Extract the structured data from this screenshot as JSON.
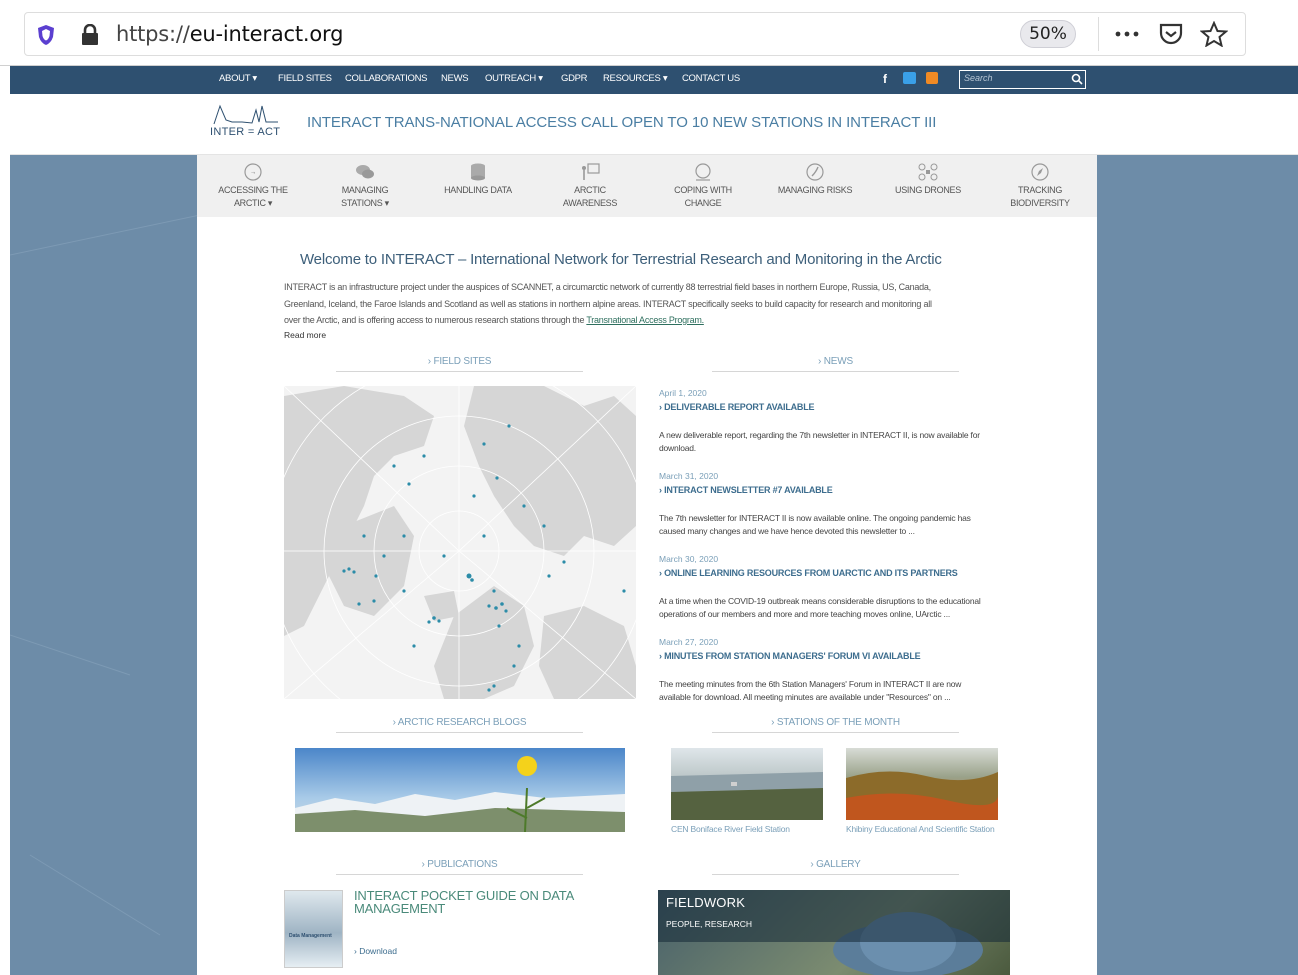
{
  "browser": {
    "url_scheme": "https://",
    "url_host": "eu-interact.org",
    "zoom": "50%"
  },
  "nav": {
    "items": [
      "ABOUT ▾",
      "FIELD SITES",
      "COLLABORATIONS",
      "NEWS",
      "OUTREACH ▾",
      "GDPR",
      "RESOURCES ▾",
      "CONTACT US"
    ],
    "search_placeholder": "Search"
  },
  "header": {
    "logo_text": "INTER = ACT",
    "headline": "INTERACT TRANS-NATIONAL ACCESS CALL OPEN TO 10 NEW STATIONS IN INTERACT III"
  },
  "iconbar": [
    {
      "line1": "ACCESSING THE",
      "line2": "ARCTIC ▾",
      "icon": "arrow-circle-icon"
    },
    {
      "line1": "MANAGING",
      "line2": "STATIONS ▾",
      "icon": "chat-bubbles-icon"
    },
    {
      "line1": "HANDLING DATA",
      "line2": "",
      "icon": "database-icon"
    },
    {
      "line1": "ARCTIC",
      "line2": "AWARENESS",
      "icon": "presentation-icon"
    },
    {
      "line1": "COPING WITH",
      "line2": "CHANGE",
      "icon": "globe-icon"
    },
    {
      "line1": "MANAGING RISKS",
      "line2": "",
      "icon": "warning-circle-icon"
    },
    {
      "line1": "USING DRONES",
      "line2": "",
      "icon": "drone-icon"
    },
    {
      "line1": "TRACKING",
      "line2": "BIODIVERSITY",
      "icon": "compass-icon"
    }
  ],
  "welcome": {
    "title": "Welcome to INTERACT – International Network for Terrestrial Research and Monitoring in the Arctic",
    "para_line1": "INTERACT is an infrastructure project under the auspices of SCANNET, a circumarctic network of currently 88 terrestrial field bases in northern Europe, Russia, US, Canada,",
    "para_line2": "Greenland, Iceland, the Faroe Islands and Scotland as well as stations in northern alpine areas. INTERACT specifically seeks to build capacity for research and monitoring all",
    "para_line3_pre": "over the Arctic, and is offering access to numerous research stations through the ",
    "para_link": "Transnational Access Program.",
    "read_more": "Read more"
  },
  "sections": {
    "field_sites": "› FIELD SITES",
    "news": "› NEWS",
    "blogs": "› ARCTIC RESEARCH BLOGS",
    "stations": "› STATIONS OF THE MONTH",
    "publications": "› PUBLICATIONS",
    "gallery": "› GALLERY"
  },
  "news": [
    {
      "date": "April 1, 2020",
      "title": "› DELIVERABLE REPORT AVAILABLE",
      "line1": "A new deliverable report, regarding the 7th newsletter in INTERACT II, is now available for",
      "line2": "download."
    },
    {
      "date": "March 31, 2020",
      "title": "› INTERACT NEWSLETTER #7 AVAILABLE",
      "line1": "The 7th newsletter for INTERACT II is now available online. The ongoing pandemic has",
      "line2": "caused many changes and we have hence devoted this newsletter to ..."
    },
    {
      "date": "March 30, 2020",
      "title": "› ONLINE LEARNING RESOURCES FROM UARCTIC AND ITS PARTNERS",
      "line1": "At a time when the COVID-19 outbreak means considerable disruptions to the educational",
      "line2": "operations of our members and more and more teaching moves online, UArctic ..."
    },
    {
      "date": "March 27, 2020",
      "title": "› MINUTES FROM STATION MANAGERS' FORUM VI AVAILABLE",
      "line1": "The meeting minutes from the 6th Station Managers' Forum in INTERACT II are now",
      "line2": "available for download. All meeting minutes are available under \"Resources\" on ..."
    }
  ],
  "stations": [
    {
      "caption": "CEN Boniface River Field Station"
    },
    {
      "caption": "Khibiny Educational And Scientific Station"
    }
  ],
  "publication": {
    "title_line1": "INTERACT POCKET GUIDE ON DATA",
    "title_line2": "MANAGEMENT",
    "download": "› Download",
    "cover_title": "Data Management"
  },
  "gallery": {
    "title": "FIELDWORK",
    "tags": "PEOPLE, RESEARCH"
  },
  "colors": {
    "nav_bg": "#2e5070",
    "accent": "#4a7ea3",
    "side_bg": "#6d8ca8",
    "map_dot": "#2c8ca8"
  }
}
